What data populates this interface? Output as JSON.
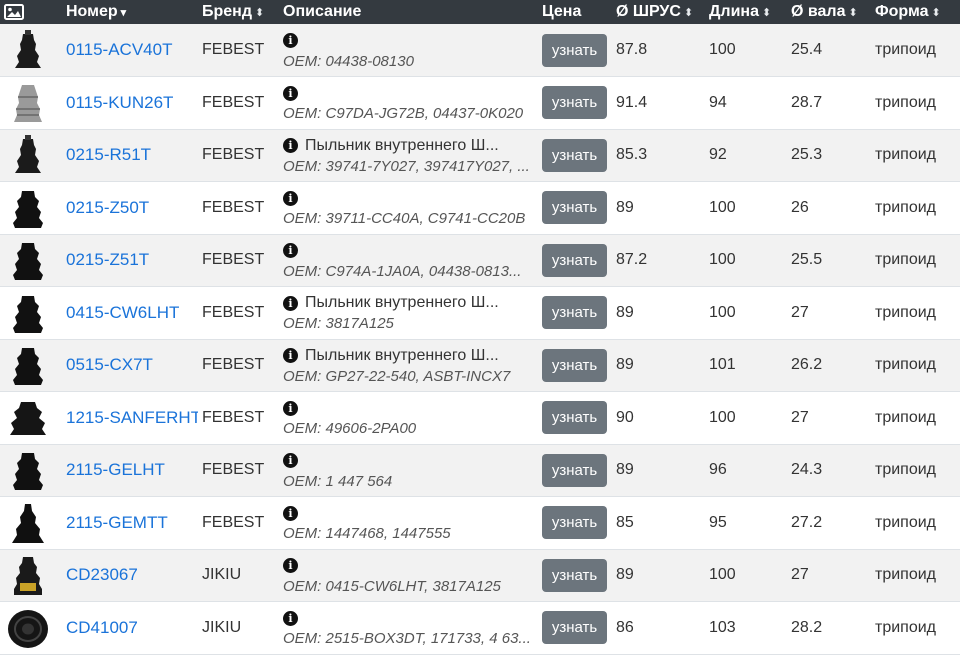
{
  "header": {
    "image_icon": "image-icon",
    "number": "Номер",
    "brand": "Бренд",
    "description": "Описание",
    "price": "Цена",
    "joint_diameter": "Ø ШРУС",
    "length": "Длина",
    "shaft_diameter": "Ø вала",
    "shape": "Форма",
    "sort_glyph": "⬍",
    "caret_glyph": "▾"
  },
  "price_button_label": "узнать",
  "rows": [
    {
      "number": "0115-ACV40T",
      "brand": "FEBEST",
      "desc": "",
      "oem": "OEM: 04438-08130",
      "joint": "87.8",
      "length": "100",
      "shaft": "25.4",
      "shape": "трипоид",
      "thumb": "slim"
    },
    {
      "number": "0115-KUN26T",
      "brand": "FEBEST",
      "desc": "",
      "oem": "OEM: C97DA-JG72B, 04437-0K020",
      "joint": "91.4",
      "length": "94",
      "shaft": "28.7",
      "shape": "трипоид",
      "thumb": "grey"
    },
    {
      "number": "0215-R51T",
      "brand": "FEBEST",
      "desc": "Пыльник внутреннего Ш...",
      "oem": "OEM: 39741-7Y027, 397417Y027, ...",
      "joint": "85.3",
      "length": "92",
      "shaft": "25.3",
      "shape": "трипоид",
      "thumb": "slim"
    },
    {
      "number": "0215-Z50T",
      "brand": "FEBEST",
      "desc": "",
      "oem": "OEM: 39711-CC40A, C9741-CC20B",
      "joint": "89",
      "length": "100",
      "shaft": "26",
      "shape": "трипоид",
      "thumb": "dark"
    },
    {
      "number": "0215-Z51T",
      "brand": "FEBEST",
      "desc": "",
      "oem": "OEM: C974A-1JA0A, 04438-0813...",
      "joint": "87.2",
      "length": "100",
      "shaft": "25.5",
      "shape": "трипоид",
      "thumb": "dark"
    },
    {
      "number": "0415-CW6LHT",
      "brand": "FEBEST",
      "desc": "Пыльник внутреннего Ш...",
      "oem": "OEM: 3817A125",
      "joint": "89",
      "length": "100",
      "shaft": "27",
      "shape": "трипоид",
      "thumb": "dark"
    },
    {
      "number": "0515-CX7T",
      "brand": "FEBEST",
      "desc": "Пыльник внутреннего Ш...",
      "oem": "OEM: GP27-22-540, ASBT-INCX7",
      "joint": "89",
      "length": "101",
      "shaft": "26.2",
      "shape": "трипоид",
      "thumb": "dark"
    },
    {
      "number": "1215-SANFERHT",
      "brand": "FEBEST",
      "desc": "",
      "oem": "OEM: 49606-2PA00",
      "joint": "90",
      "length": "100",
      "shaft": "27",
      "shape": "трипоид",
      "thumb": "wide"
    },
    {
      "number": "2115-GELHT",
      "brand": "FEBEST",
      "desc": "",
      "oem": "OEM: 1 447 564",
      "joint": "89",
      "length": "96",
      "shaft": "24.3",
      "shape": "трипоид",
      "thumb": "dark"
    },
    {
      "number": "2115-GEMTT",
      "brand": "FEBEST",
      "desc": "",
      "oem": "OEM: 1447468, 1447555",
      "joint": "85",
      "length": "95",
      "shaft": "27.2",
      "shape": "трипоид",
      "thumb": "cone"
    },
    {
      "number": "CD23067",
      "brand": "JIKIU",
      "desc": "",
      "oem": "OEM: 0415-CW6LHT, 3817A125",
      "joint": "89",
      "length": "100",
      "shaft": "27",
      "shape": "трипоид",
      "thumb": "box"
    },
    {
      "number": "CD41007",
      "brand": "JIKIU",
      "desc": "",
      "oem": "OEM: 2515-BOX3DT, 171733, 4 63...",
      "joint": "86",
      "length": "103",
      "shaft": "28.2",
      "shape": "трипоид",
      "thumb": "round"
    }
  ],
  "colors": {
    "header_bg": "#343a40",
    "link": "#1a73d9",
    "button_bg": "#6c757d",
    "row_stripe": "#f2f2f2"
  }
}
